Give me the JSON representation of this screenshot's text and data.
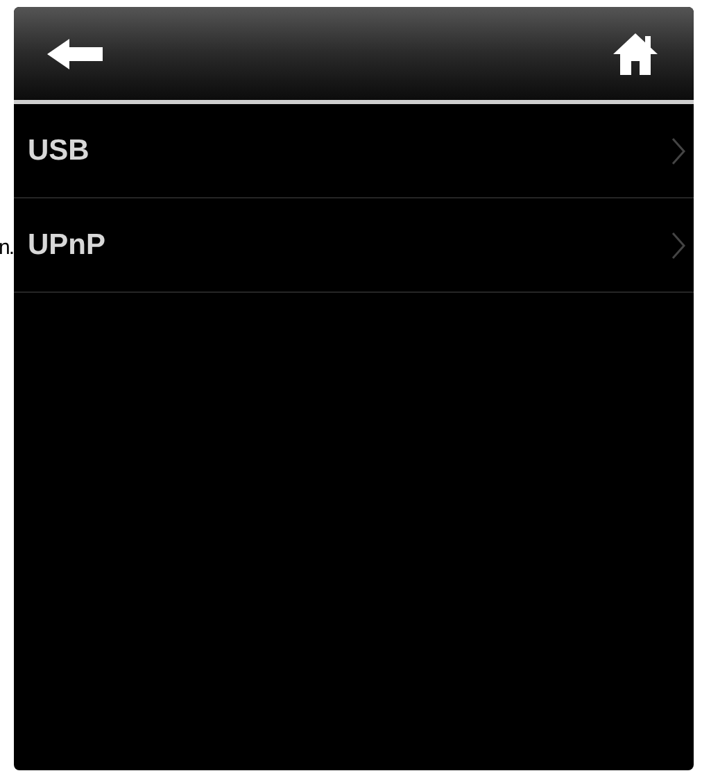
{
  "edge_fragment": "n.",
  "menu": {
    "items": [
      {
        "label": "USB"
      },
      {
        "label": "UPnP"
      }
    ]
  }
}
